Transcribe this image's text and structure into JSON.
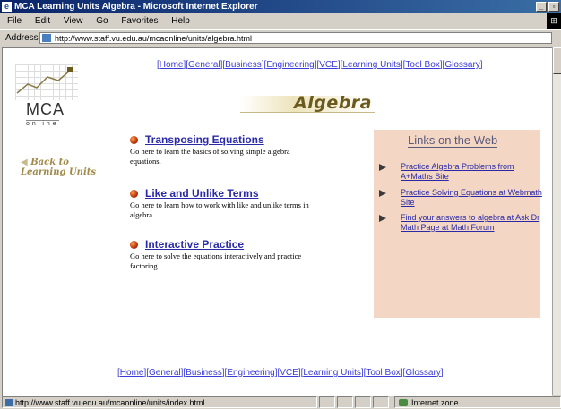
{
  "window": {
    "title": "MCA Learning Units Algebra - Microsoft Internet Explorer",
    "menu": [
      "File",
      "Edit",
      "View",
      "Go",
      "Favorites",
      "Help"
    ],
    "address_label": "Address",
    "address_url": "http://www.staff.vu.edu.au/mcaonline/units/algebra.html",
    "status_text": "http://www.staff.vu.edu.au/mcaonline/units/index.html",
    "zone_text": "Internet zone"
  },
  "nav": [
    "Home",
    "General",
    "Business",
    "Engineering",
    "VCE",
    "Learning Units",
    "Tool Box",
    "Glossary"
  ],
  "logo": {
    "text": "MCA",
    "subtext": "online"
  },
  "back_link": {
    "line1": "Back to",
    "line2": "Learning Units"
  },
  "page_title": "Algebra",
  "topics": [
    {
      "title": "Transposing Equations",
      "desc": "Go here to learn the basics of solving simple algebra equations."
    },
    {
      "title": "Like and Unlike Terms",
      "desc": "Go here to learn how to work with like and unlike terms in algebra."
    },
    {
      "title": "Interactive Practice",
      "desc": "Go here to solve the equations interactively and practice factoring."
    }
  ],
  "links_box": {
    "heading": "Links on the Web",
    "links": [
      "Practice Algebra Problems from A+Maths Site",
      "Practice Solving Equations at Webmath Site",
      "Find your answers to algebra at Ask Dr Math Page at Math Forum"
    ]
  },
  "colors": {
    "link": "#2a2aa8",
    "box_bg": "#f3d6c4",
    "title_bar": "#0a246a"
  }
}
